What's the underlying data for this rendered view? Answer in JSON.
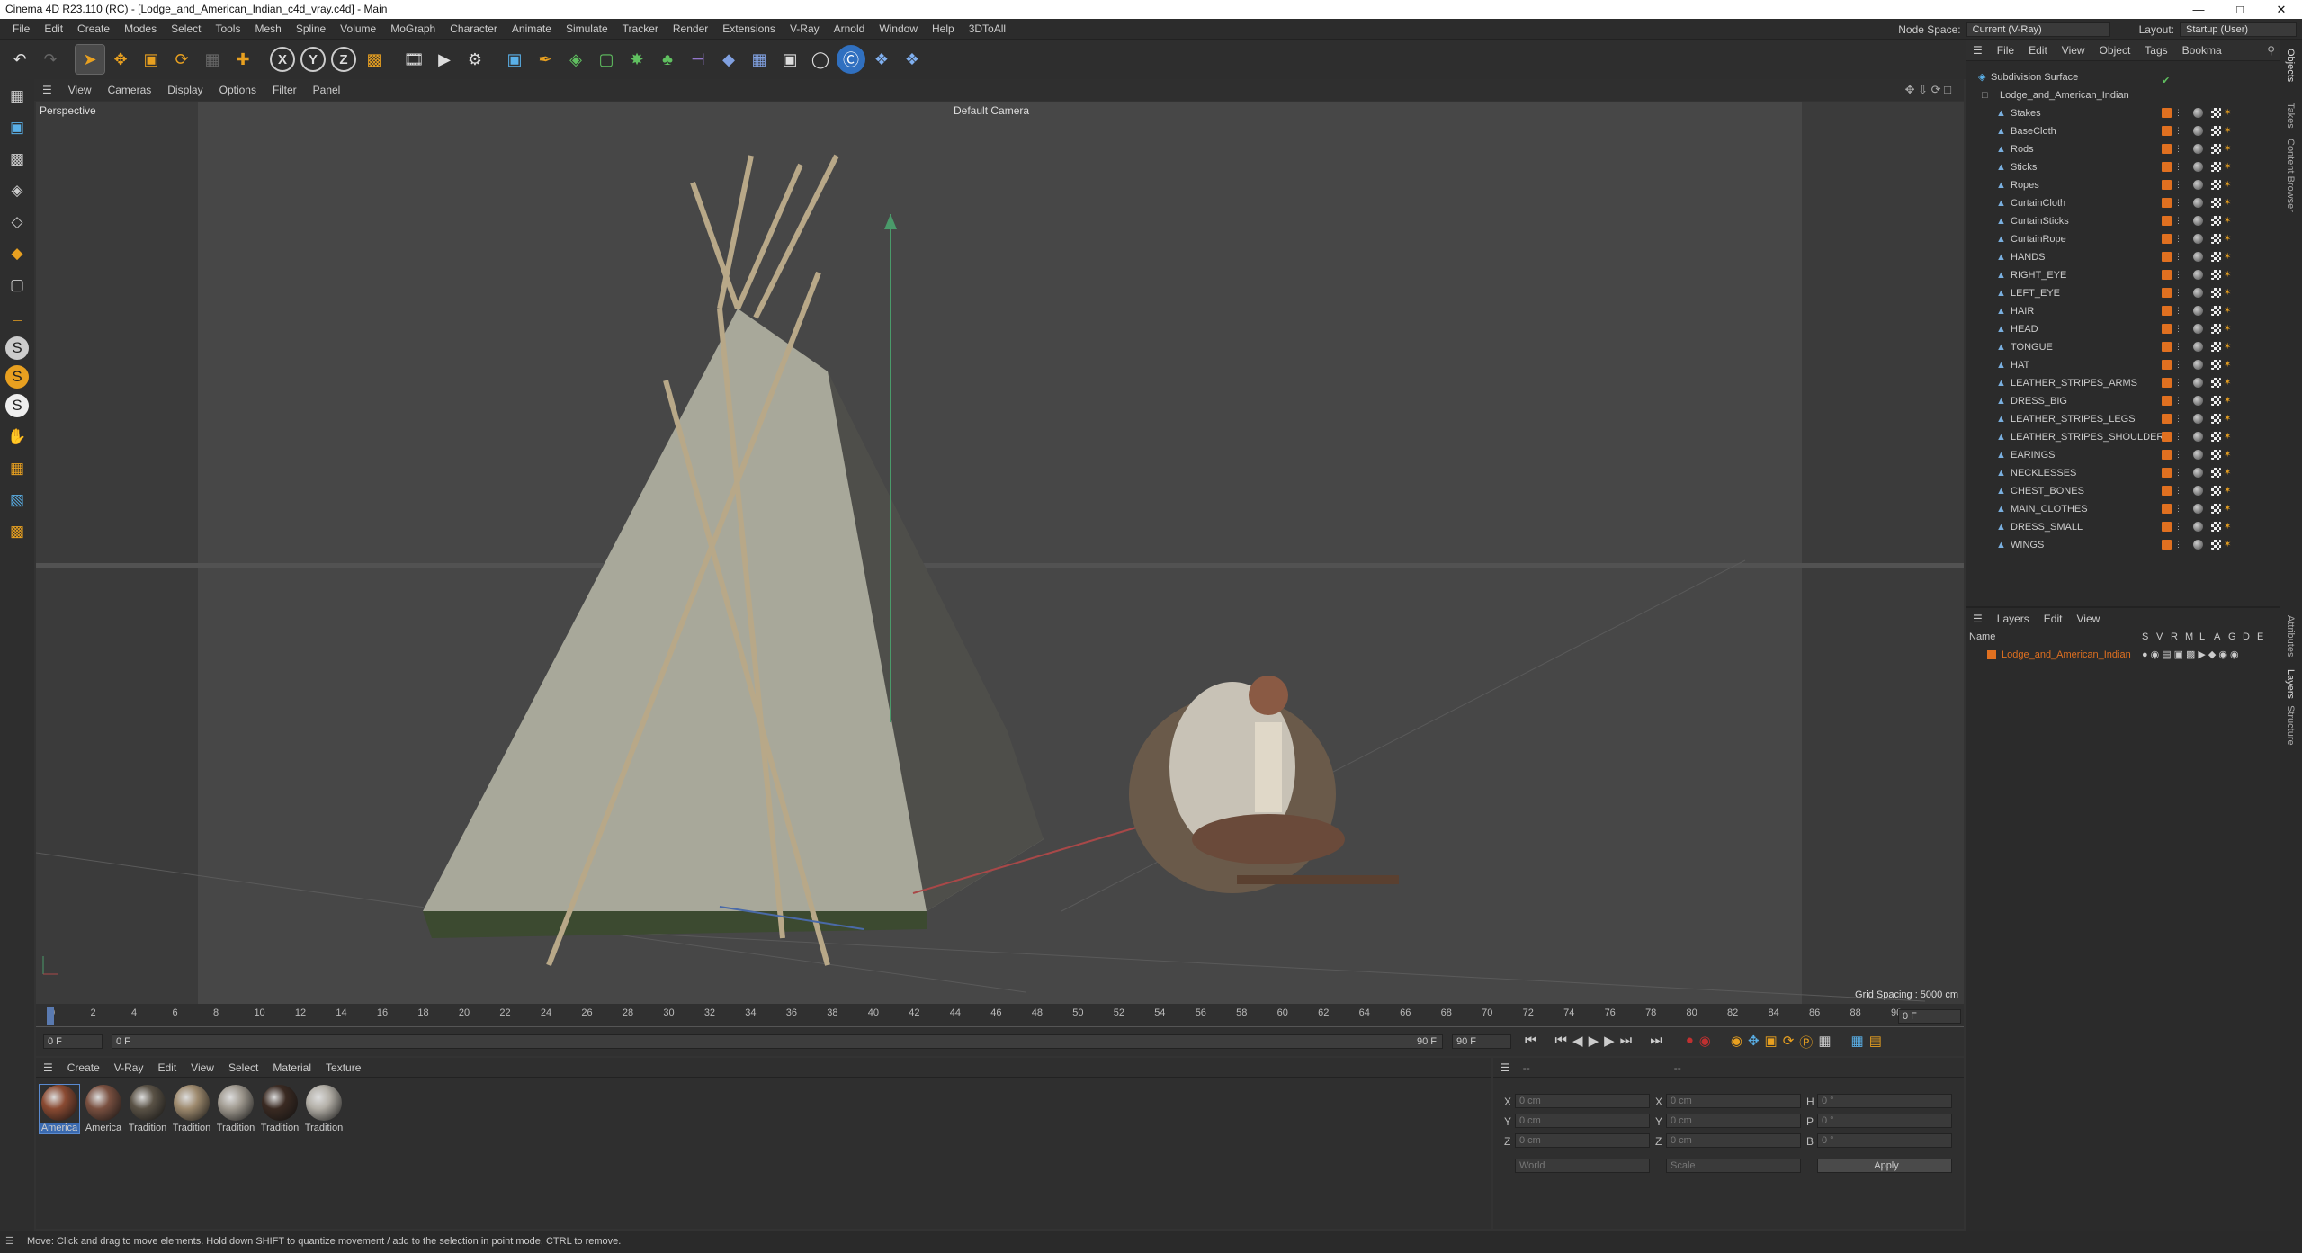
{
  "title": "Cinema 4D R23.110 (RC) - [Lodge_and_American_Indian_c4d_vray.c4d] - Main",
  "menu": [
    "File",
    "Edit",
    "Create",
    "Modes",
    "Select",
    "Tools",
    "Mesh",
    "Spline",
    "Volume",
    "MoGraph",
    "Character",
    "Animate",
    "Simulate",
    "Tracker",
    "Render",
    "Extensions",
    "V-Ray",
    "Arnold",
    "Window",
    "Help",
    "3DToAll"
  ],
  "node_space_label": "Node Space:",
  "node_space_value": "Current (V-Ray)",
  "layout_label": "Layout:",
  "layout_value": "Startup (User)",
  "viewport": {
    "menu": [
      "View",
      "Cameras",
      "Display",
      "Options",
      "Filter",
      "Panel"
    ],
    "view_name": "Perspective",
    "camera": "Default Camera",
    "grid_spacing": "Grid Spacing : 5000 cm"
  },
  "timeline": {
    "ticks": [
      "0",
      "2",
      "4",
      "6",
      "8",
      "10",
      "12",
      "14",
      "16",
      "18",
      "20",
      "22",
      "24",
      "26",
      "28",
      "30",
      "32",
      "34",
      "36",
      "38",
      "40",
      "42",
      "44",
      "46",
      "48",
      "50",
      "52",
      "54",
      "56",
      "58",
      "60",
      "62",
      "64",
      "66",
      "68",
      "70",
      "72",
      "74",
      "76",
      "78",
      "80",
      "82",
      "84",
      "86",
      "88",
      "90"
    ],
    "current_frame": "0 F",
    "start": "0 F",
    "start2": "0 F",
    "end": "90 F",
    "end2": "90 F"
  },
  "materials": {
    "menu": [
      "Create",
      "V-Ray",
      "Edit",
      "View",
      "Select",
      "Material",
      "Texture"
    ],
    "items": [
      {
        "name": "America",
        "color": "#8a4a32"
      },
      {
        "name": "America",
        "color": "#7a5040"
      },
      {
        "name": "Tradition",
        "color": "#5a5246"
      },
      {
        "name": "Tradition",
        "color": "#9e8a6e"
      },
      {
        "name": "Tradition",
        "color": "#a09a90"
      },
      {
        "name": "Tradition",
        "color": "#3a2a22"
      },
      {
        "name": "Tradition",
        "color": "#b2aea6"
      }
    ]
  },
  "attributes": {
    "x": "0 cm",
    "y": "0 cm",
    "z": "0 cm",
    "x2": "0 cm",
    "y2": "0 cm",
    "z2": "0 cm",
    "h": "0 °",
    "p": "0 °",
    "b": "0 °",
    "coord_mode": "World",
    "scale_mode": "Scale",
    "apply": "Apply",
    "labels": {
      "x": "X",
      "y": "Y",
      "z": "Z",
      "h": "H",
      "p": "P",
      "b": "B"
    },
    "dash1": "--",
    "dash2": "--"
  },
  "objects": {
    "menu": [
      "File",
      "Edit",
      "View",
      "Object",
      "Tags",
      "Bookma"
    ],
    "root": "Subdivision Surface",
    "group": "Lodge_and_American_Indian",
    "children": [
      "Stakes",
      "BaseCloth",
      "Rods",
      "Sticks",
      "Ropes",
      "CurtainCloth",
      "CurtainSticks",
      "CurtainRope",
      "HANDS",
      "RIGHT_EYE",
      "LEFT_EYE",
      "HAIR",
      "HEAD",
      "TONGUE",
      "HAT",
      "LEATHER_STRIPES_ARMS",
      "DRESS_BIG",
      "LEATHER_STRIPES_LEGS",
      "LEATHER_STRIPES_SHOULDERS",
      "EARINGS",
      "NECKLESSES",
      "CHEST_BONES",
      "MAIN_CLOTHES",
      "DRESS_SMALL",
      "WINGS"
    ]
  },
  "layers": {
    "menu": [
      "Layers",
      "Edit",
      "View"
    ],
    "header_name": "Name",
    "columns": [
      "S",
      "V",
      "R",
      "M",
      "L",
      "A",
      "G",
      "D",
      "E"
    ],
    "items": [
      "Lodge_and_American_Indian"
    ],
    "layer_color": "#e07020"
  },
  "right_tabs": [
    "Objects",
    "Takes",
    "Content Browser",
    "Attributes",
    "Layers",
    "Structure"
  ],
  "status": "Move: Click and drag to move elements. Hold down SHIFT to quantize movement / add to the selection in point mode, CTRL to remove."
}
